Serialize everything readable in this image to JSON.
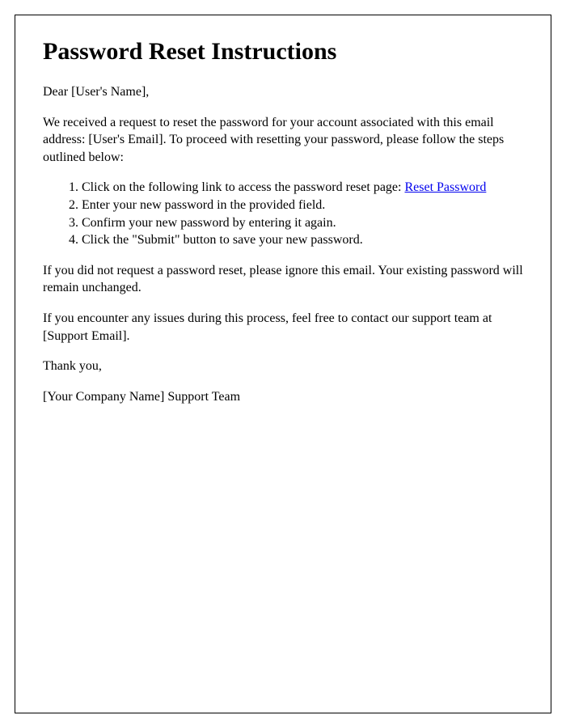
{
  "title": "Password Reset Instructions",
  "greeting": "Dear [User's Name],",
  "intro": "We received a request to reset the password for your account associated with this email address: [User's Email]. To proceed with resetting your password, please follow the steps outlined below:",
  "steps": {
    "step1_prefix": "Click on the following link to access the password reset page: ",
    "step1_link": "Reset Password",
    "step2": "Enter your new password in the provided field.",
    "step3": "Confirm your new password by entering it again.",
    "step4": "Click the \"Submit\" button to save your new password."
  },
  "ignore_note": "If you did not request a password reset, please ignore this email. Your existing password will remain unchanged.",
  "support_note": "If you encounter any issues during this process, feel free to contact our support team at [Support Email].",
  "thank_you": "Thank you,",
  "signature": "[Your Company Name] Support Team"
}
